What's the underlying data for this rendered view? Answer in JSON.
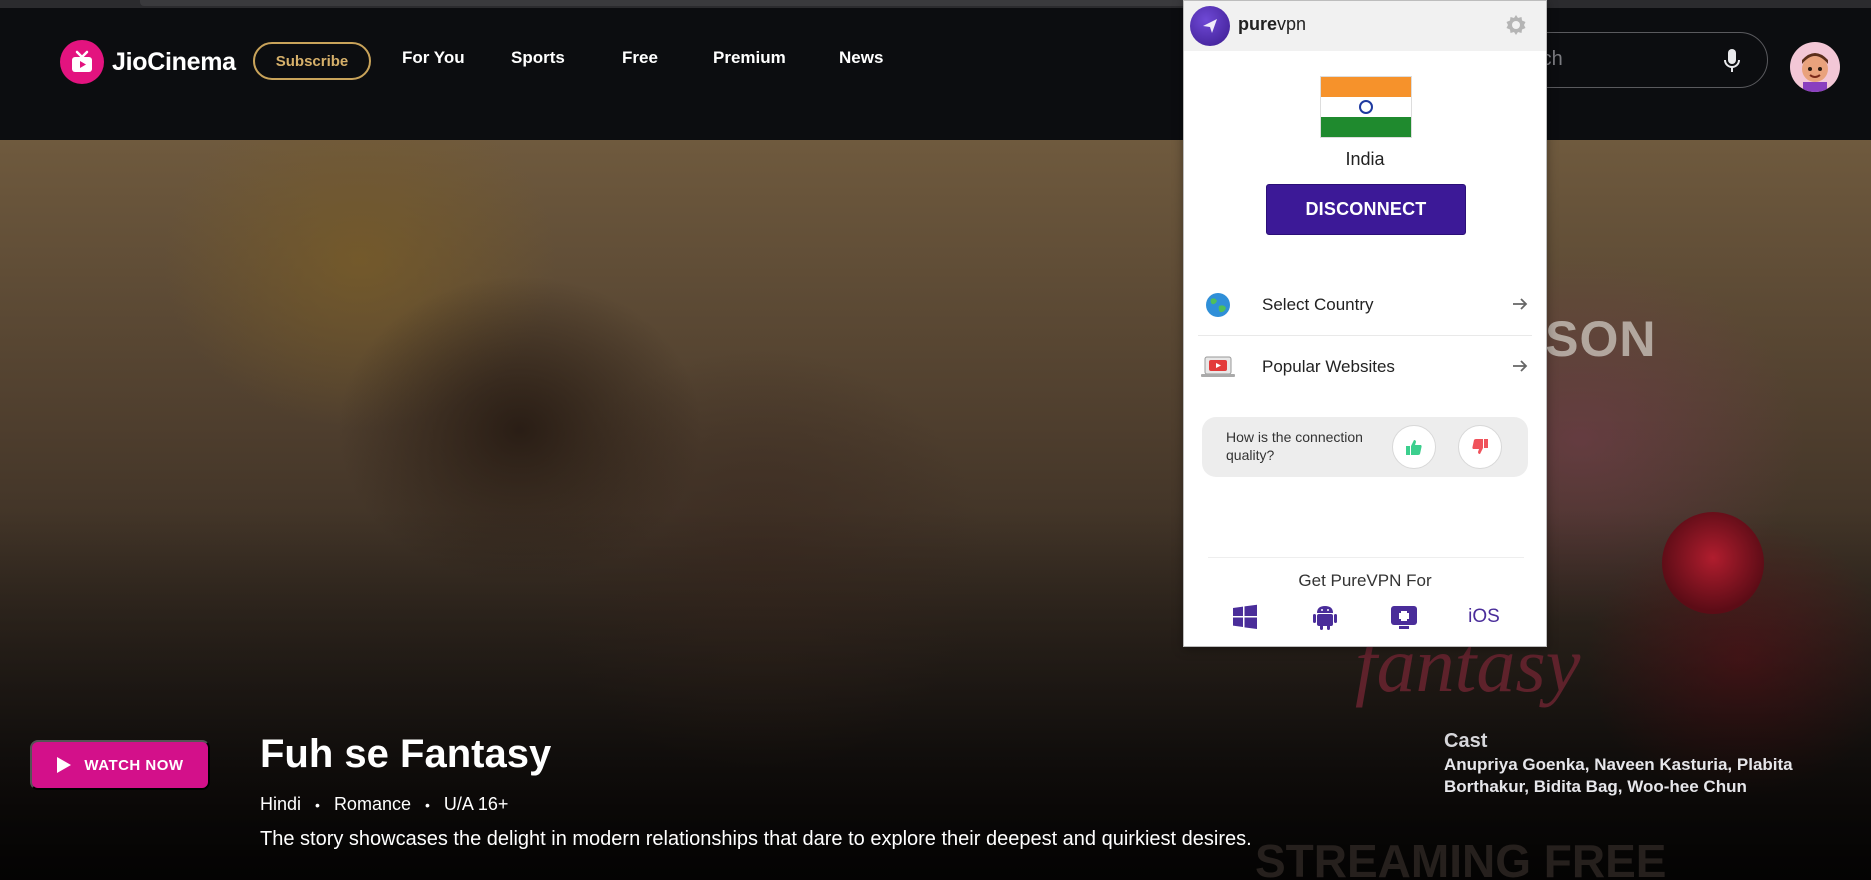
{
  "app": {
    "brand": "JioCinema",
    "subscribe_label": "Subscribe",
    "nav": [
      "For You",
      "Sports",
      "Free",
      "Premium",
      "News"
    ],
    "search_placeholder": "rch",
    "colors": {
      "accent": "#e3137f",
      "subscribe_gold": "#c9a35a",
      "header_bg": "#0c0d10"
    }
  },
  "hero": {
    "watch_label": "WATCH NOW",
    "title": "Fuh se Fantasy",
    "language": "Hindi",
    "genre": "Romance",
    "rating": "U/A 16+",
    "description": "The story showcases the delight in modern relationships that dare to explore their deepest and quirkiest desires.",
    "cast_heading": "Cast",
    "cast_names": "Anupriya Goenka, Naveen Kasturia, Plabita Borthakur, Bidita Bag, Woo-hee Chun",
    "poster_text": "ASON",
    "poster_logo": "fantasy",
    "poster_footer": "STREAMING FREE"
  },
  "vpn": {
    "brand_bold": "pure",
    "brand_light": "vpn",
    "country": "India",
    "disconnect_label": "DISCONNECT",
    "menu": [
      {
        "label": "Select Country",
        "icon": "globe-icon"
      },
      {
        "label": "Popular Websites",
        "icon": "laptop-play-icon"
      }
    ],
    "feedback_question": "How is the connection quality?",
    "get_heading": "Get PureVPN For",
    "platforms": [
      "windows-icon",
      "android-icon",
      "tv-icon",
      "iOS"
    ],
    "colors": {
      "primary": "#3c1997",
      "thumbs_up": "#3ccf8e",
      "thumbs_down": "#f0525b"
    }
  }
}
